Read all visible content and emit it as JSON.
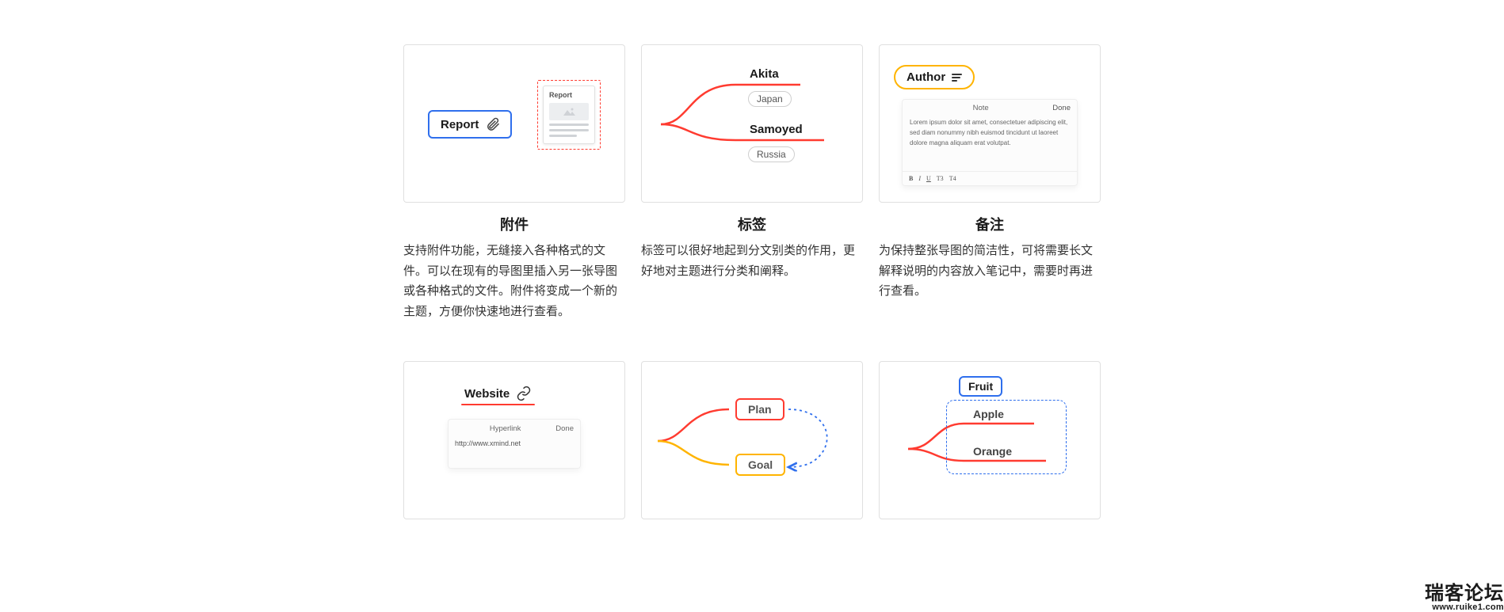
{
  "features": [
    {
      "title": "附件",
      "desc": "支持附件功能，无缝接入各种格式的文件。可以在现有的导图里插入另一张导图或各种格式的文件。附件将变成一个新的主题，方便你快速地进行查看。",
      "node_label": "Report",
      "doc_title": "Report"
    },
    {
      "title": "标签",
      "desc": "标签可以很好地起到分文别类的作用，更好地对主题进行分类和阐释。",
      "branch1": "Akita",
      "tag1": "Japan",
      "branch2": "Samoyed",
      "tag2": "Russia"
    },
    {
      "title": "备注",
      "desc": "为保持整张导图的简洁性，可将需要长文解释说明的内容放入笔记中，需要时再进行查看。",
      "chip": "Author",
      "panel_title": "Note",
      "panel_done": "Done",
      "panel_body": "Lorem ipsum dolor sit amet, consectetuer adipiscing elit, sed diam nonummy nibh euismod tincidunt ut laoreet dolore magna aliquam erat volutpat.",
      "tb": {
        "b": "B",
        "i": "I",
        "u": "U",
        "t3": "T3",
        "t4": "T4"
      }
    },
    {
      "title": "",
      "chip": "Website",
      "panel_title": "Hyperlink",
      "panel_done": "Done",
      "url": "http://www.xmind.net"
    },
    {
      "title": "",
      "node1": "Plan",
      "node2": "Goal"
    },
    {
      "title": "",
      "root": "Fruit",
      "child1": "Apple",
      "child2": "Orange"
    }
  ],
  "watermark": {
    "line1": "瑞客论坛",
    "line2": "www.ruike1.com"
  }
}
